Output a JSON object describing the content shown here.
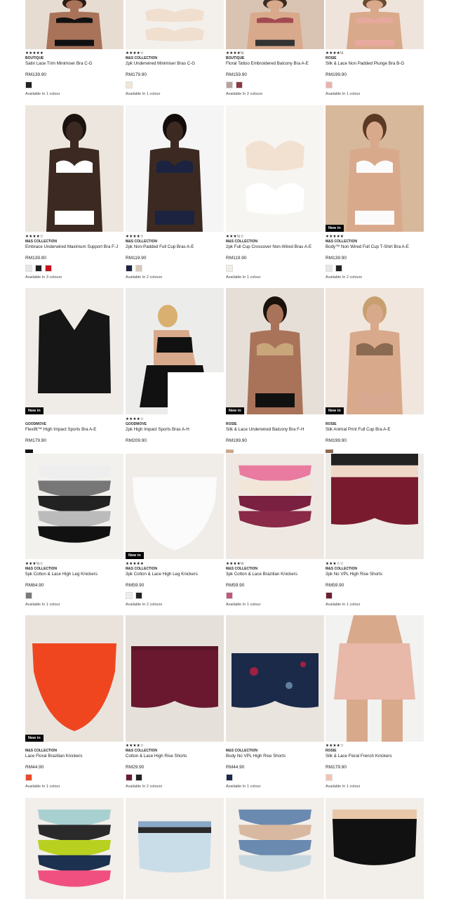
{
  "new_label": "New in",
  "rows": [
    {
      "products": [
        {
          "stars": "★★★★★",
          "brand": "BOUTIQUE",
          "name": "Satin Lace Trim Minimiser Bra C-G",
          "price": "RM139.90",
          "availability": "Available In 1 colour",
          "swatches": [
            "#222222"
          ],
          "image": "model-black-bra"
        },
        {
          "stars": "★★★★☆",
          "brand": "M&S COLLECTION",
          "name": "2pk Underwired Minimiser Bras C-G",
          "price": "RM179.90",
          "availability": "Available In 1 colour",
          "swatches": [
            "#f2e6d8"
          ],
          "image": "bra-nude-product"
        },
        {
          "stars": "★★★★½",
          "brand": "BOUTIQUE",
          "name": "Floral Tattoo Embroidered Balcony Bra A-E",
          "price": "RM159.90",
          "availability": "Available In 2 colours",
          "swatches": [
            "#b7a3a0",
            "#8a3a44"
          ],
          "image": "model-floral-bra"
        },
        {
          "stars": "★★★★½",
          "brand": "ROSIE",
          "name": "Silk & Lace Non Padded Plunge Bra B-G",
          "price": "RM199.90",
          "availability": "Available In 1 colour",
          "swatches": [
            "#e9b3ac"
          ],
          "image": "model-pink-bra"
        }
      ]
    },
    {
      "products": [
        {
          "stars": "★★★★☆",
          "brand": "M&S COLLECTION",
          "name": "Embrace Underwired Maximum Support Bra F-J",
          "price": "RM139.90",
          "availability": "Available In 3 colours",
          "swatches": [
            "#e6e6e6",
            "#222222",
            "#c4141d"
          ],
          "image": "model-white-lace-bra"
        },
        {
          "stars": "★★★★☆",
          "brand": "M&S COLLECTION",
          "name": "2pk Non-Padded Full Cup Bras A-E",
          "price": "RM119.90",
          "availability": "Available In 2 colours",
          "swatches": [
            "#1c2340",
            "#d8c8b8"
          ],
          "image": "model-navy-bra"
        },
        {
          "stars": "★★★½☆",
          "brand": "M&S COLLECTION",
          "name": "2pk Full Cup Crossover Non-Wired Bras A-E",
          "price": "RM119.90",
          "availability": "Available In 1 colour",
          "swatches": [
            "#f3ece3"
          ],
          "image": "bra-white-product"
        },
        {
          "stars": "★★★★★",
          "brand": "M&S COLLECTION",
          "name": "Body™ Non Wired Full Cup T-Shirt Bra A-E",
          "price": "RM139.90",
          "availability": "Available In 2 colours",
          "swatches": [
            "#e6e6e6",
            "#222222"
          ],
          "image": "model-white-tshirt-bra",
          "new": true
        }
      ]
    },
    {
      "products": [
        {
          "stars": "",
          "brand": "GOODMOVE",
          "name": "Flexifit™ High Impact Sports Bra A-E",
          "price": "RM179.90",
          "availability": "",
          "swatches": [],
          "small_swatch": "#111111",
          "image": "sports-bra-product",
          "new": true
        },
        {
          "stars": "★★★★☆",
          "brand": "GOODMOVE",
          "name": "2pk High Impact Sports Bras A-H",
          "price": "RM209.90",
          "availability": "",
          "swatches": [],
          "image": "model-sports-bra"
        },
        {
          "stars": "",
          "brand": "ROSIE",
          "name": "Silk & Lace Underwired Balcony Bra F-H",
          "price": "RM199.90",
          "availability": "",
          "swatches": [],
          "small_swatch": "#c9a890",
          "image": "model-leopard-bra",
          "new": true
        },
        {
          "stars": "",
          "brand": "ROSIE",
          "name": "Silk Animal Print Full Cup Bra A-E",
          "price": "RM199.90",
          "availability": "",
          "swatches": [],
          "small_swatch": "#8a6a55",
          "image": "model-animal-bra",
          "new": true
        }
      ]
    },
    {
      "products": [
        {
          "stars": "★★★½☆",
          "brand": "M&S COLLECTION",
          "name": "5pk Cotton & Lace High Leg Knickers",
          "price": "RM84.90",
          "availability": "Available In 1 colour",
          "swatches": [
            "#7a7a7a"
          ],
          "image": "knickers-stack-bw",
          "new": false
        },
        {
          "stars": "★★★★★",
          "brand": "M&S COLLECTION",
          "name": "3pk Cotton & Lace High Leg Knickers",
          "price": "RM59.90",
          "availability": "Available In 2 colours",
          "swatches": [
            "#eeeeee",
            "#222222"
          ],
          "image": "knickers-white",
          "new": true
        },
        {
          "stars": "★★★★½",
          "brand": "M&S COLLECTION",
          "name": "3pk Cotton & Lace Brazilian Knickers",
          "price": "RM59.90",
          "availability": "Available In 1 colour",
          "swatches": [
            "#c0587a"
          ],
          "image": "knickers-floral-burgundy"
        },
        {
          "stars": "★★★☆☆",
          "brand": "M&S COLLECTION",
          "name": "3pk No VPL High Rise Shorts",
          "price": "RM59.90",
          "availability": "Available In 1 colour",
          "swatches": [
            "#6e2030"
          ],
          "image": "shorts-burgundy"
        }
      ]
    },
    {
      "products": [
        {
          "stars": "",
          "brand": "M&S COLLECTION",
          "name": "Lace Floral Brazilian Knickers",
          "price": "RM44.90",
          "availability": "Available In 1 colour",
          "swatches": [
            "#ea4a2a"
          ],
          "image": "knickers-orange",
          "new": true
        },
        {
          "stars": "★★★★☆",
          "brand": "M&S COLLECTION",
          "name": "Cotton & Lace High Rise Shorts",
          "price": "RM29.90",
          "availability": "Available In 2 colours",
          "swatches": [
            "#6a1a32",
            "#222222"
          ],
          "image": "shorts-plum"
        },
        {
          "stars": "",
          "brand": "M&S COLLECTION",
          "name": "Body No VPL High Rise Shorts",
          "price": "RM44.90",
          "availability": "Available In 1 colour",
          "swatches": [
            "#1c2a4a"
          ],
          "image": "shorts-navy-print"
        },
        {
          "stars": "★★★★☆",
          "brand": "ROSIE",
          "name": "Silk & Lace Floral French Knickers",
          "price": "RM179.90",
          "availability": "Available In 1 colour",
          "swatches": [
            "#f2c3b4"
          ],
          "image": "model-french-knickers"
        }
      ]
    },
    {
      "products": [
        {
          "image": "knickers-multipack-bright"
        },
        {
          "image": "knickers-blue-floral"
        },
        {
          "image": "knickers-floral-multipack"
        },
        {
          "image": "knickers-black-nude"
        }
      ]
    }
  ]
}
